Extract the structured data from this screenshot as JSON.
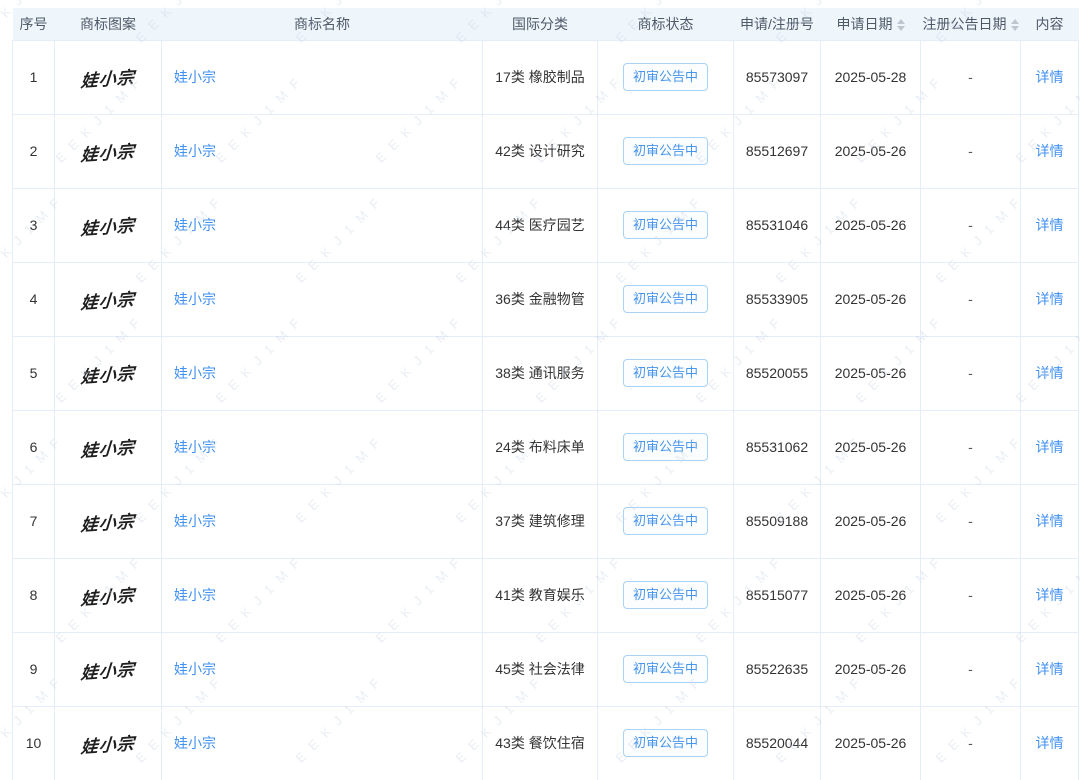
{
  "watermark": {
    "text": "EEKJ1MF"
  },
  "colors": {
    "accent_blue": "#4191f2",
    "header_bg": "#eef5fb",
    "row_border": "#e4edf8",
    "status_text": "#4795ec",
    "status_border": "#a9d2f5",
    "sort_caret": "#c0c6cf"
  },
  "table": {
    "columns": [
      {
        "key": "index",
        "label": "序号",
        "sortable": false
      },
      {
        "key": "mark_image",
        "label": "商标图案",
        "sortable": false
      },
      {
        "key": "name",
        "label": "商标名称",
        "sortable": false
      },
      {
        "key": "classification",
        "label": "国际分类",
        "sortable": false
      },
      {
        "key": "status",
        "label": "商标状态",
        "sortable": false
      },
      {
        "key": "app_number",
        "label": "申请/注册号",
        "sortable": false
      },
      {
        "key": "app_date",
        "label": "申请日期",
        "sortable": true
      },
      {
        "key": "reg_pub_date",
        "label": "注册公告日期",
        "sortable": true
      },
      {
        "key": "action",
        "label": "内容",
        "sortable": false
      }
    ],
    "rows": [
      {
        "index": "1",
        "mark_image": "娃小宗",
        "name": "娃小宗",
        "classification": "17类 橡胶制品",
        "status": "初审公告中",
        "app_number": "85573097",
        "app_date": "2025-05-28",
        "reg_pub_date": "-",
        "action": "详情"
      },
      {
        "index": "2",
        "mark_image": "娃小宗",
        "name": "娃小宗",
        "classification": "42类 设计研究",
        "status": "初审公告中",
        "app_number": "85512697",
        "app_date": "2025-05-26",
        "reg_pub_date": "-",
        "action": "详情"
      },
      {
        "index": "3",
        "mark_image": "娃小宗",
        "name": "娃小宗",
        "classification": "44类 医疗园艺",
        "status": "初审公告中",
        "app_number": "85531046",
        "app_date": "2025-05-26",
        "reg_pub_date": "-",
        "action": "详情"
      },
      {
        "index": "4",
        "mark_image": "娃小宗",
        "name": "娃小宗",
        "classification": "36类 金融物管",
        "status": "初审公告中",
        "app_number": "85533905",
        "app_date": "2025-05-26",
        "reg_pub_date": "-",
        "action": "详情"
      },
      {
        "index": "5",
        "mark_image": "娃小宗",
        "name": "娃小宗",
        "classification": "38类 通讯服务",
        "status": "初审公告中",
        "app_number": "85520055",
        "app_date": "2025-05-26",
        "reg_pub_date": "-",
        "action": "详情"
      },
      {
        "index": "6",
        "mark_image": "娃小宗",
        "name": "娃小宗",
        "classification": "24类 布料床单",
        "status": "初审公告中",
        "app_number": "85531062",
        "app_date": "2025-05-26",
        "reg_pub_date": "-",
        "action": "详情"
      },
      {
        "index": "7",
        "mark_image": "娃小宗",
        "name": "娃小宗",
        "classification": "37类 建筑修理",
        "status": "初审公告中",
        "app_number": "85509188",
        "app_date": "2025-05-26",
        "reg_pub_date": "-",
        "action": "详情"
      },
      {
        "index": "8",
        "mark_image": "娃小宗",
        "name": "娃小宗",
        "classification": "41类 教育娱乐",
        "status": "初审公告中",
        "app_number": "85515077",
        "app_date": "2025-05-26",
        "reg_pub_date": "-",
        "action": "详情"
      },
      {
        "index": "9",
        "mark_image": "娃小宗",
        "name": "娃小宗",
        "classification": "45类 社会法律",
        "status": "初审公告中",
        "app_number": "85522635",
        "app_date": "2025-05-26",
        "reg_pub_date": "-",
        "action": "详情"
      },
      {
        "index": "10",
        "mark_image": "娃小宗",
        "name": "娃小宗",
        "classification": "43类 餐饮住宿",
        "status": "初审公告中",
        "app_number": "85520044",
        "app_date": "2025-05-26",
        "reg_pub_date": "-",
        "action": "详情"
      }
    ]
  }
}
